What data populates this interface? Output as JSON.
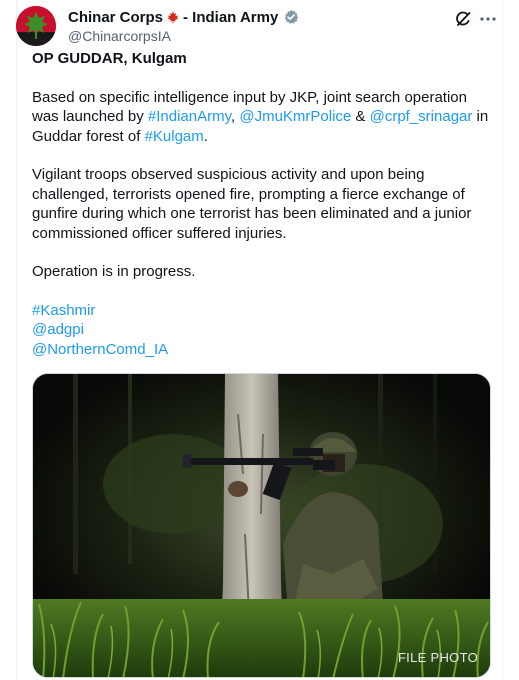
{
  "author": {
    "display_name": "Chinar Corps",
    "name_suffix": " - Indian Army",
    "handle": "@ChinarcorpsIA"
  },
  "icons": {
    "avatar": "chinar-leaf-logo",
    "flag": "maple-leaf-emoji",
    "verified": "verified-badge-icon",
    "grok": "grok-icon",
    "more": "more-icon"
  },
  "colors": {
    "link": "#1d9bf0",
    "verified": "#829aab",
    "avatar_bg": "#c8102e",
    "avatar_leaf": "#3a8f2a"
  },
  "post": {
    "title": "OP GUDDAR, Kulgam",
    "p1": {
      "t1": "Based on specific intelligence input by JKP, joint search operation was launched by ",
      "l1": "#IndianArmy",
      "t2": ", ",
      "l2": "@JmuKmrPolice",
      "t3": " & ",
      "l3": "@crpf_srinagar",
      "t4": " in Guddar forest of ",
      "l4": "#Kulgam",
      "t5": "."
    },
    "p2": "Vigilant troops observed suspicious activity and upon being challenged, terrorists opened fire, prompting a fierce exchange of gunfire during which one terrorist has been eliminated and a junior commissioned officer suffered injuries.",
    "p3": "Operation is in progress.",
    "tags": [
      "#Kashmir",
      "@adgpi",
      "@NorthernComd_IA"
    ]
  },
  "media": {
    "watermark": "FILE PHOTO"
  }
}
